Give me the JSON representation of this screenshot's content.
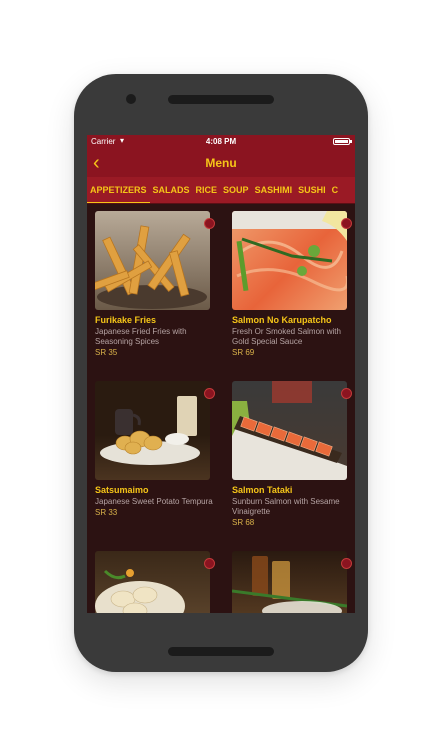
{
  "status_bar": {
    "carrier": "Carrier",
    "time": "4:08 PM"
  },
  "nav": {
    "title": "Menu",
    "back_icon": "chevron-left-icon"
  },
  "tabs": [
    "APPETIZERS",
    "SALADS",
    "RICE",
    "SOUP",
    "SASHIMI",
    "SUSHI",
    "C"
  ],
  "active_tab": "APPETIZERS",
  "items": [
    {
      "name": "Furikake Fries",
      "desc": "Japanese Fried Fries with Seasoning Spices",
      "price": "SR 35"
    },
    {
      "name": "Salmon No Karupatcho",
      "desc": "Fresh Or Smoked Salmon with Gold Special Sauce",
      "price": "SR 69"
    },
    {
      "name": "Satsumaimo",
      "desc": "Japanese Sweet Potato Tempura",
      "price": "SR 33"
    },
    {
      "name": "Salmon Tataki",
      "desc": "Sunburn Salmon with Sesame Vinaigrette",
      "price": "SR 68"
    }
  ],
  "colors": {
    "header": "#8b1420",
    "accent": "#f5c518",
    "background": "#2c1212"
  }
}
